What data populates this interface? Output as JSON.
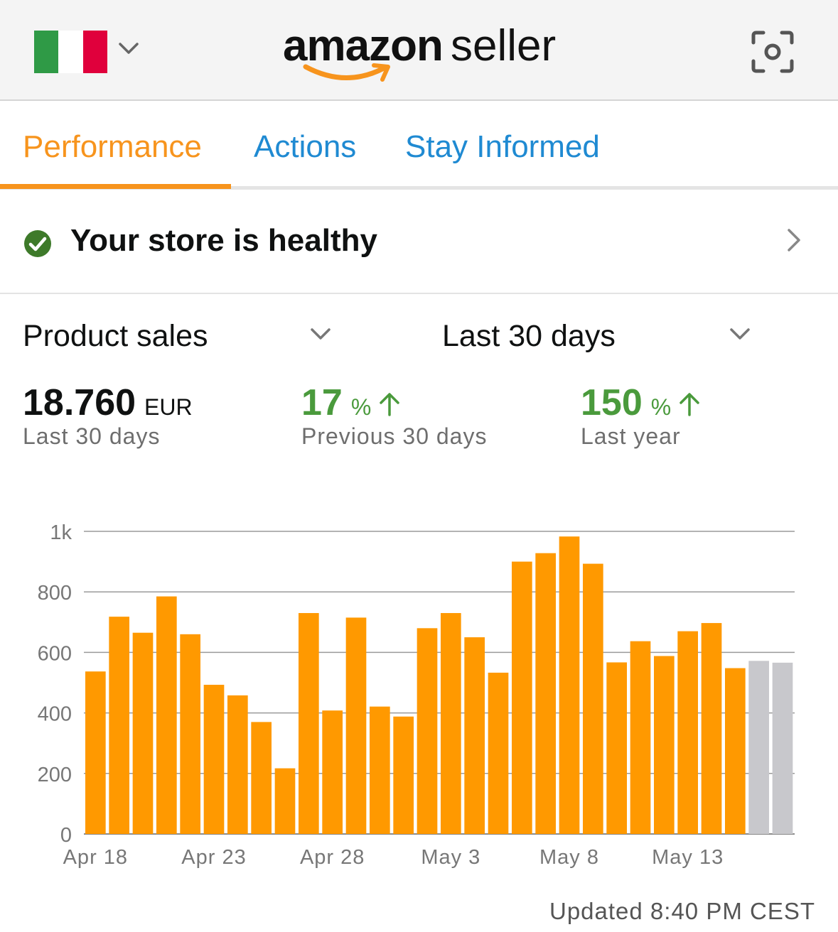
{
  "header": {
    "flag_country": "Italy",
    "flag_colors": [
      "#2f9a46",
      "#ffffff",
      "#e0003c"
    ],
    "logo_brand": "amazon",
    "logo_product": "seller",
    "icons": {
      "chevron": "chevron-down-icon",
      "scan": "scan-icon"
    }
  },
  "tabs": [
    {
      "label": "Performance",
      "active": true
    },
    {
      "label": "Actions",
      "active": false
    },
    {
      "label": "Stay Informed",
      "active": false
    }
  ],
  "health": {
    "text": "Your store is healthy",
    "icon": "check-circle-icon",
    "status_color": "#3e7a2a"
  },
  "selectors": {
    "metric": "Product sales",
    "range": "Last 30 days"
  },
  "metrics": {
    "total": {
      "value": "18.760",
      "unit": "EUR",
      "label": "Last 30 days"
    },
    "previous": {
      "value": "17",
      "unit": "%",
      "label": "Previous 30 days"
    },
    "last_year": {
      "value": "150",
      "unit": "%",
      "label": "Last year"
    }
  },
  "colors": {
    "accent": "#f7941d",
    "link": "#1f8ad2",
    "positive": "#4a9a3c",
    "bar": "#ff9900",
    "bar_pending": "#c8c8cc"
  },
  "chart_data": {
    "type": "bar",
    "categories": [
      "Apr 18",
      "Apr 19",
      "Apr 20",
      "Apr 21",
      "Apr 22",
      "Apr 23",
      "Apr 24",
      "Apr 25",
      "Apr 26",
      "Apr 27",
      "Apr 28",
      "Apr 29",
      "Apr 30",
      "May 1",
      "May 2",
      "May 3",
      "May 4",
      "May 5",
      "May 6",
      "May 7",
      "May 8",
      "May 9",
      "May 10",
      "May 11",
      "May 12",
      "May 13",
      "May 14",
      "May 15",
      "May 16",
      "May 17"
    ],
    "values": [
      537,
      718,
      665,
      785,
      660,
      493,
      458,
      370,
      217,
      730,
      408,
      715,
      421,
      388,
      680,
      730,
      650,
      533,
      900,
      928,
      983,
      893,
      567,
      637,
      588,
      670,
      697,
      548,
      572,
      566
    ],
    "pending": [
      false,
      false,
      false,
      false,
      false,
      false,
      false,
      false,
      false,
      false,
      false,
      false,
      false,
      false,
      false,
      false,
      false,
      false,
      false,
      false,
      false,
      false,
      false,
      false,
      false,
      false,
      false,
      false,
      true,
      true
    ],
    "y_ticks": [
      "0",
      "200",
      "400",
      "600",
      "800",
      "1k"
    ],
    "x_tick_labels": [
      "Apr 18",
      "Apr 23",
      "Apr 28",
      "May 3",
      "May 8",
      "May 13"
    ],
    "ylim": [
      0,
      1000
    ],
    "grid": true
  },
  "footer": {
    "updated": "Updated 8:40 PM CEST"
  }
}
